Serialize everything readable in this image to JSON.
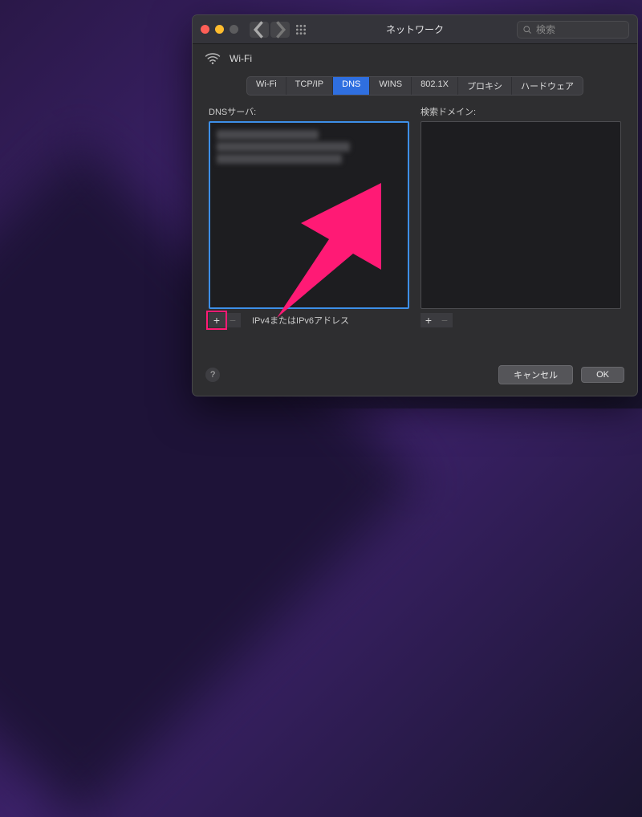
{
  "window": {
    "title": "ネットワーク",
    "search_placeholder": "検索"
  },
  "wifi_label": "Wi-Fi",
  "tabs": [
    {
      "id": "wifi",
      "label": "Wi-Fi"
    },
    {
      "id": "tcpip",
      "label": "TCP/IP"
    },
    {
      "id": "dns",
      "label": "DNS",
      "active": true
    },
    {
      "id": "wins",
      "label": "WINS"
    },
    {
      "id": "8021x",
      "label": "802.1X"
    },
    {
      "id": "proxy",
      "label": "プロキシ"
    },
    {
      "id": "hardware",
      "label": "ハードウェア"
    }
  ],
  "dns_panel": {
    "label": "DNSサーバ:",
    "hint": "IPv4またはIPv6アドレス"
  },
  "search_domain_panel": {
    "label": "検索ドメイン:"
  },
  "buttons": {
    "add": "+",
    "remove": "−",
    "help": "?",
    "cancel": "キャンセル",
    "ok": "OK"
  },
  "annotation": {
    "color": "#ff1a75"
  }
}
